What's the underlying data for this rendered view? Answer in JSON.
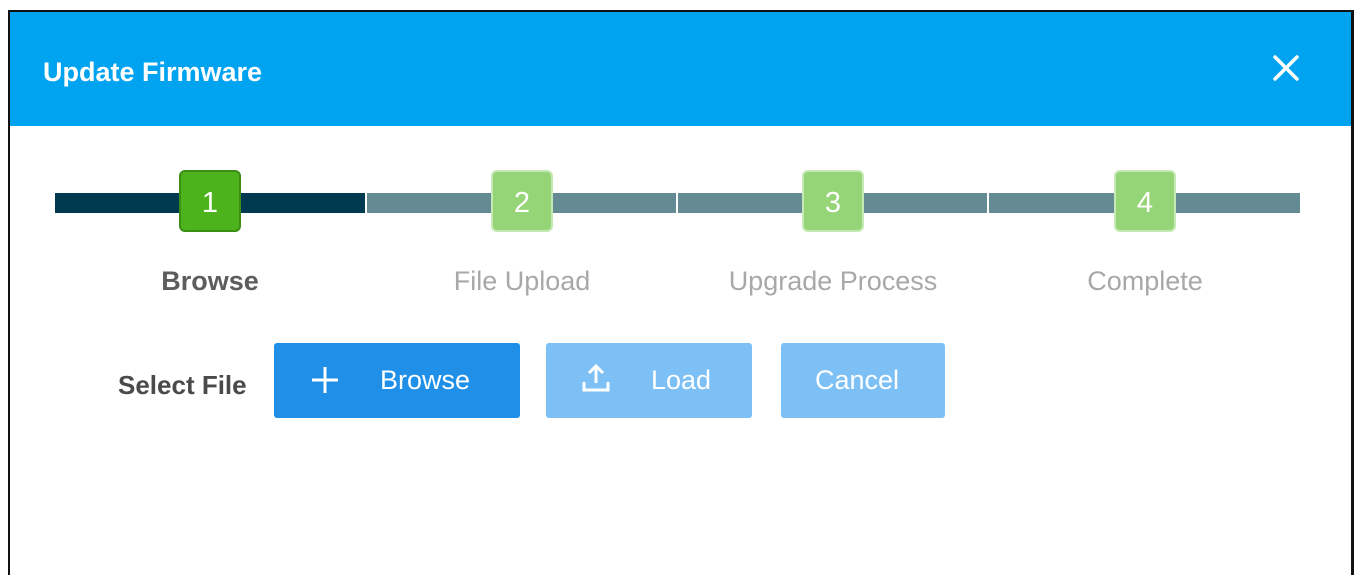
{
  "dialog": {
    "title": "Update Firmware",
    "close_icon": "close-icon"
  },
  "stepper": {
    "active_step": 1,
    "colors": {
      "active_box": "#4cb31c",
      "inactive_box": "#96d577",
      "active_track": "#003a50",
      "inactive_track": "#648a94"
    },
    "steps": [
      {
        "number": "1",
        "label": "Browse"
      },
      {
        "number": "2",
        "label": "File Upload"
      },
      {
        "number": "3",
        "label": "Upgrade Process"
      },
      {
        "number": "4",
        "label": "Complete"
      }
    ]
  },
  "actions": {
    "select_file_label": "Select File",
    "browse": {
      "label": "Browse",
      "icon": "plus-icon"
    },
    "load": {
      "label": "Load",
      "icon": "upload-icon"
    },
    "cancel": {
      "label": "Cancel"
    }
  },
  "colors": {
    "header": "#00a3f0",
    "primary_button": "#1f8fe8",
    "disabled_button": "#7cc0f6"
  }
}
